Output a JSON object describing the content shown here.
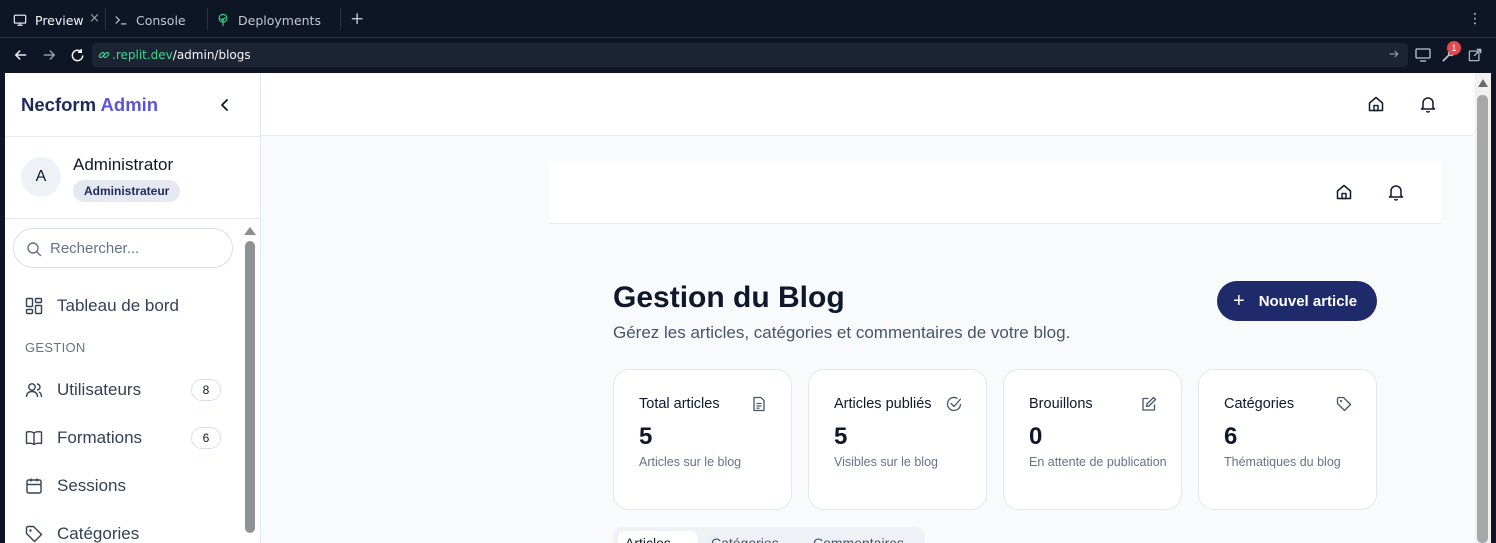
{
  "browser": {
    "tabs": [
      {
        "label": "Preview",
        "icon": "monitor-icon",
        "active": true
      },
      {
        "label": "Console",
        "icon": "terminal-icon",
        "active": false
      },
      {
        "label": "Deployments",
        "icon": "deploy-icon",
        "active": false
      }
    ],
    "url": {
      "host": ".replit.dev",
      "path": "/admin/blogs"
    },
    "notification_count": "1",
    "colors": {
      "background": "#0e1525",
      "url_field": "#1c2333",
      "url_host": "#3dd68c"
    }
  },
  "sidebar": {
    "brand": {
      "name": "Necform",
      "accent": "Admin"
    },
    "user": {
      "initial": "A",
      "name": "Administrator",
      "role": "Administrateur"
    },
    "search": {
      "placeholder": "Rechercher..."
    },
    "dashboard_label": "Tableau de bord",
    "section_label": "GESTION",
    "items": [
      {
        "label": "Utilisateurs",
        "count": "8",
        "icon": "users-icon"
      },
      {
        "label": "Formations",
        "count": "6",
        "icon": "book-icon"
      },
      {
        "label": "Sessions",
        "icon": "calendar-icon"
      },
      {
        "label": "Catégories",
        "icon": "tag-icon"
      }
    ]
  },
  "main": {
    "title": "Gestion du Blog",
    "subtitle": "Gérez les articles, catégories et commentaires de votre blog.",
    "new_button": "Nouvel article",
    "stats": [
      {
        "title": "Total articles",
        "value": "5",
        "description": "Articles sur le blog",
        "icon": "document-icon"
      },
      {
        "title": "Articles publiés",
        "value": "5",
        "description": "Visibles sur le blog",
        "icon": "check-circle-icon"
      },
      {
        "title": "Brouillons",
        "value": "0",
        "description": "En attente de publication",
        "icon": "edit-icon"
      },
      {
        "title": "Catégories",
        "value": "6",
        "description": "Thématiques du blog",
        "icon": "tag-icon"
      }
    ],
    "tabs": [
      "Articles",
      "Catégories",
      "Commentaires"
    ]
  },
  "theme": {
    "primary": "#1e2a6a",
    "brand_accent": "#5b56d6",
    "text": "#0f172a",
    "muted": "#64748b"
  }
}
